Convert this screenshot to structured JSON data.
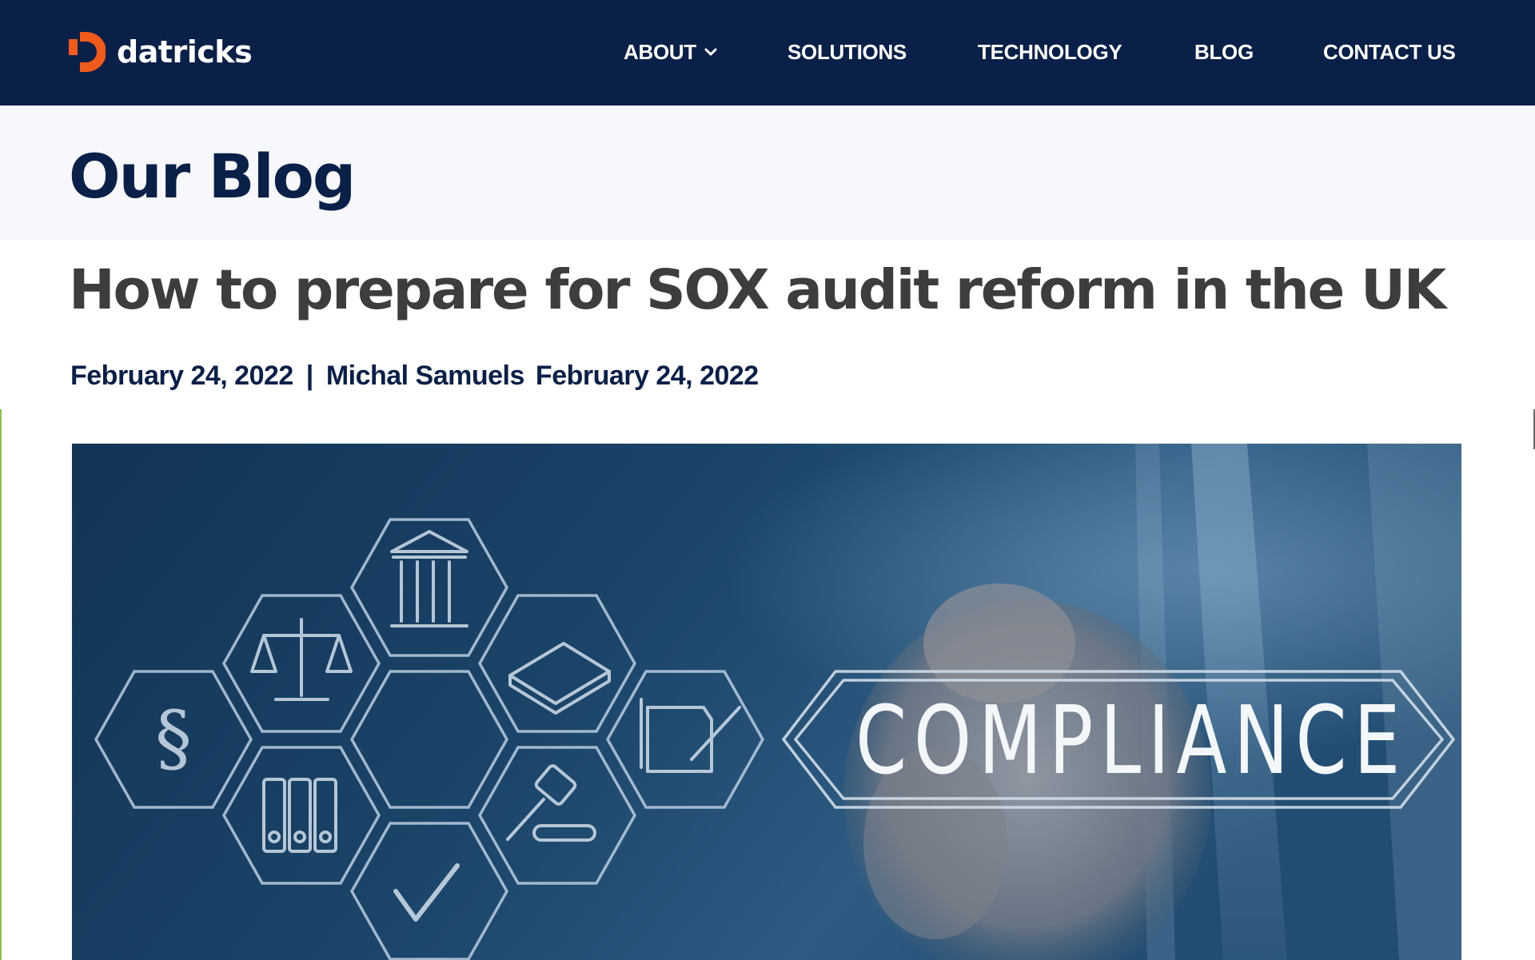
{
  "header": {
    "logo_text": "datricks",
    "nav": [
      {
        "label": "ABOUT",
        "has_dropdown": true
      },
      {
        "label": "SOLUTIONS"
      },
      {
        "label": "TECHNOLOGY"
      },
      {
        "label": "BLOG"
      },
      {
        "label": "CONTACT US"
      }
    ]
  },
  "page": {
    "title": "Our Blog"
  },
  "post": {
    "title": "How to prepare for SOX audit reform in the UK",
    "date": "February 24, 2022",
    "separator": "|",
    "author": "Michal Samuels",
    "updated_date": "February 24, 2022"
  },
  "hero": {
    "banner_text": "COMPLIANCE"
  },
  "colors": {
    "header_bg": "#0a2049",
    "brand_orange": "#f05a1a",
    "title_navy": "#0a2049",
    "post_title_gray": "#3d3d3f",
    "band_bg": "#f7f8fc"
  }
}
